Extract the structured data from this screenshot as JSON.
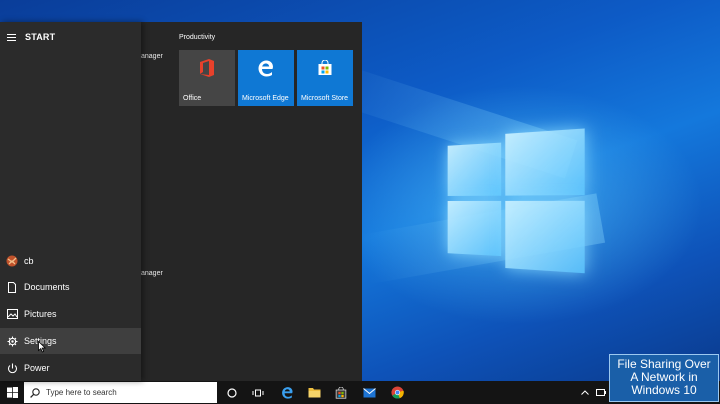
{
  "start_menu": {
    "title": "START",
    "partial_labels": [
      "anager",
      "anager"
    ],
    "rail_items": [
      {
        "label": "cb",
        "icon": "user-avatar-icon"
      },
      {
        "label": "Documents",
        "icon": "document-icon"
      },
      {
        "label": "Pictures",
        "icon": "pictures-icon"
      },
      {
        "label": "Settings",
        "icon": "gear-icon"
      },
      {
        "label": "Power",
        "icon": "power-icon"
      }
    ],
    "group_title": "Productivity",
    "tiles": [
      {
        "label": "Office",
        "icon": "office-icon",
        "color": "#454545"
      },
      {
        "label": "Microsoft Edge",
        "icon": "edge-icon",
        "color": "#0f78d4"
      },
      {
        "label": "Microsoft Store",
        "icon": "store-icon",
        "color": "#0f78d4"
      }
    ]
  },
  "taskbar": {
    "search_placeholder": "Type here to search",
    "pinned": [
      "cortana-icon",
      "task-view-icon",
      "edge-icon",
      "file-explorer-icon",
      "store-icon",
      "mail-icon",
      "chrome-icon"
    ],
    "tray": [
      "chevron-up-icon",
      "battery-icon",
      "network-icon"
    ]
  },
  "caption": {
    "line1": "File Sharing Over",
    "line2": "A Network in",
    "line3": "Windows 10"
  },
  "colors": {
    "accent": "#0f78d4",
    "taskbar": "#141414",
    "start_bg": "#262626"
  }
}
